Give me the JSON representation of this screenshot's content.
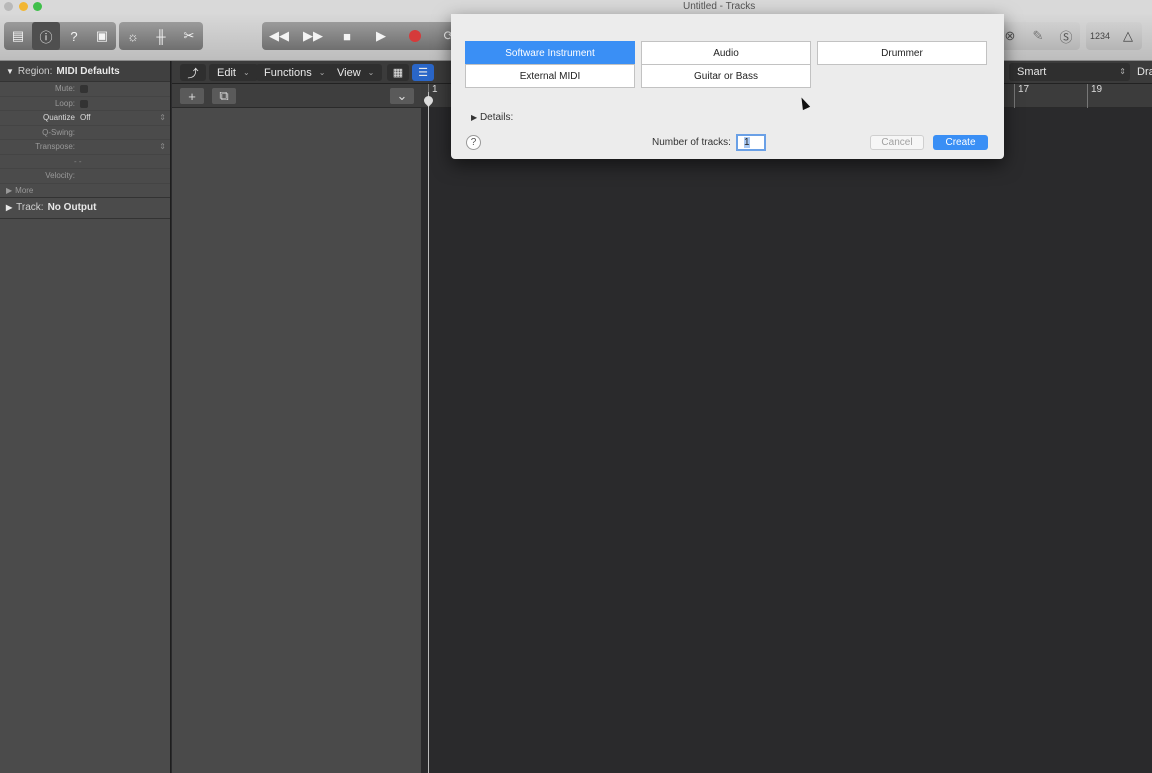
{
  "window": {
    "title": "Untitled - Tracks"
  },
  "toolbar": {
    "lcd_label": "1234",
    "icons": [
      "library-icon",
      "inspector-icon",
      "help-icon",
      "toolbar-icon",
      "smart-controls-icon",
      "mixer-icon",
      "scissors-icon",
      "rewind-icon",
      "forward-icon",
      "stop-icon",
      "play-icon",
      "record-icon",
      "cycle-icon"
    ]
  },
  "inspector": {
    "region_key": "Region:",
    "region_value": "MIDI Defaults",
    "rows": [
      {
        "label": "Mute:",
        "value": ""
      },
      {
        "label": "Loop:",
        "value": ""
      },
      {
        "label": "Quantize",
        "value": "Off"
      },
      {
        "label": "Q-Swing:",
        "value": ""
      },
      {
        "label": "Transpose:",
        "value": ""
      },
      {
        "label": "",
        "value": "- -"
      },
      {
        "label": "Velocity:",
        "value": ""
      }
    ],
    "more": "More",
    "track_key": "Track:",
    "track_value": "No Output"
  },
  "edit_bar": {
    "edit": "Edit",
    "functions": "Functions",
    "view": "View"
  },
  "ruler": {
    "ticks": [
      "1",
      "17",
      "19"
    ]
  },
  "right_controls": {
    "tool": "Smart",
    "draw": "Dra"
  },
  "dialog": {
    "options": [
      "Software Instrument",
      "Audio",
      "Drummer",
      "External MIDI",
      "Guitar or Bass"
    ],
    "selected": "Software Instrument",
    "details": "Details:",
    "tracks_label": "Number of tracks:",
    "tracks_value": "1",
    "cancel": "Cancel",
    "create": "Create",
    "help": "?"
  },
  "colors": {
    "accent": "#3a8ff5",
    "record": "#d63a3a"
  }
}
